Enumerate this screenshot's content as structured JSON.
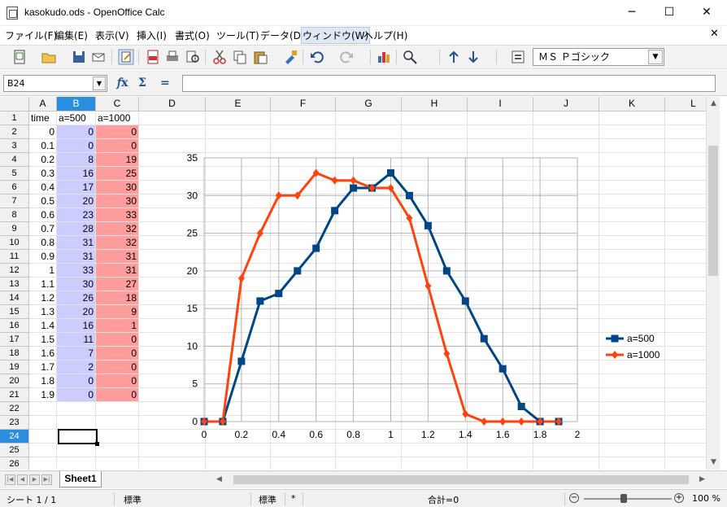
{
  "window": {
    "title": "kasokudo.ods - OpenOffice Calc",
    "minimize_glyph": "─",
    "maximize_glyph": "☐",
    "close_glyph": "✕",
    "doc_close_glyph": "✕"
  },
  "menu": {
    "items": [
      "ファイル(F)",
      "編集(E)",
      "表示(V)",
      "挿入(I)",
      "書式(O)",
      "ツール(T)",
      "データ(D)",
      "ウィンドウ(W)",
      "ヘルプ(H)"
    ],
    "active_index": 7
  },
  "toolbar": {
    "icons": [
      "new-document-icon",
      "open-folder-icon",
      "save-icon",
      "email-icon",
      "edit-document-icon",
      "export-pdf-icon",
      "print-icon",
      "print-preview-icon",
      "cut-icon",
      "copy-icon",
      "paste-icon",
      "clone-formatting-icon",
      "undo-icon",
      "redo-icon",
      "chart-icon",
      "find-icon",
      "sort-ascending-icon",
      "sort-descending-icon",
      "navigator-icon"
    ],
    "font_name": "ＭＳ Ｐゴシック"
  },
  "formula_bar": {
    "cell_reference": "B24",
    "formula_value": "",
    "fx_glyph": "𝑓x",
    "sum_glyph": "Σ",
    "equals_glyph": "="
  },
  "sheet": {
    "columns": [
      "A",
      "B",
      "C",
      "D",
      "E",
      "F",
      "G",
      "H",
      "I",
      "J",
      "K",
      "L"
    ],
    "selected_column": "B",
    "rows": [
      "1",
      "2",
      "3",
      "4",
      "5",
      "6",
      "7",
      "8",
      "9",
      "10",
      "11",
      "12",
      "13",
      "14",
      "15",
      "16",
      "17",
      "18",
      "19",
      "20",
      "21",
      "22",
      "23",
      "24",
      "25",
      "26"
    ],
    "selected_row": "24",
    "headers": [
      "time",
      "a=500",
      "a=1000"
    ],
    "data": [
      [
        "0",
        "0",
        "0"
      ],
      [
        "0.1",
        "0",
        "0"
      ],
      [
        "0.2",
        "8",
        "19"
      ],
      [
        "0.3",
        "16",
        "25"
      ],
      [
        "0.4",
        "17",
        "30"
      ],
      [
        "0.5",
        "20",
        "30"
      ],
      [
        "0.6",
        "23",
        "33"
      ],
      [
        "0.7",
        "28",
        "32"
      ],
      [
        "0.8",
        "31",
        "32"
      ],
      [
        "0.9",
        "31",
        "31"
      ],
      [
        "1",
        "33",
        "31"
      ],
      [
        "1.1",
        "30",
        "27"
      ],
      [
        "1.2",
        "26",
        "18"
      ],
      [
        "1.3",
        "20",
        "9"
      ],
      [
        "1.4",
        "16",
        "1"
      ],
      [
        "1.5",
        "11",
        "0"
      ],
      [
        "1.6",
        "7",
        "0"
      ],
      [
        "1.7",
        "2",
        "0"
      ],
      [
        "1.8",
        "0",
        "0"
      ],
      [
        "1.9",
        "0",
        "0"
      ]
    ],
    "colors": {
      "col_b": "#cccdfe",
      "col_c": "#ff9d9d",
      "selection": "#2b8de0"
    }
  },
  "chart_data": {
    "type": "line",
    "x": [
      0,
      0.1,
      0.2,
      0.3,
      0.4,
      0.5,
      0.6,
      0.7,
      0.8,
      0.9,
      1,
      1.1,
      1.2,
      1.3,
      1.4,
      1.5,
      1.6,
      1.7,
      1.8,
      1.9
    ],
    "series": [
      {
        "name": "a=500",
        "color": "#004586",
        "marker": "square",
        "values": [
          0,
          0,
          8,
          16,
          17,
          20,
          23,
          28,
          31,
          31,
          33,
          30,
          26,
          20,
          16,
          11,
          7,
          2,
          0,
          0
        ]
      },
      {
        "name": "a=1000",
        "color": "#ff420e",
        "marker": "diamond",
        "values": [
          0,
          0,
          19,
          25,
          30,
          30,
          33,
          32,
          32,
          31,
          31,
          27,
          18,
          9,
          1,
          0,
          0,
          0,
          0,
          0
        ]
      }
    ],
    "xlim": [
      0,
      2
    ],
    "ylim": [
      0,
      35
    ],
    "x_ticks": [
      "0",
      "0.2",
      "0.4",
      "0.6",
      "0.8",
      "1",
      "1.2",
      "1.4",
      "1.6",
      "1.8",
      "2"
    ],
    "y_ticks": [
      "0",
      "5",
      "10",
      "15",
      "20",
      "25",
      "30",
      "35"
    ],
    "grid": true,
    "legend": "right",
    "title": "",
    "xlabel": "",
    "ylabel": ""
  },
  "tabs": {
    "sheets": [
      "Sheet1"
    ],
    "active": "Sheet1"
  },
  "status": {
    "sheet_position": "シート 1 / 1",
    "page_style": "標準",
    "mode": "標準",
    "modified": "*",
    "sum": "合計=0",
    "zoom": "100 %"
  }
}
